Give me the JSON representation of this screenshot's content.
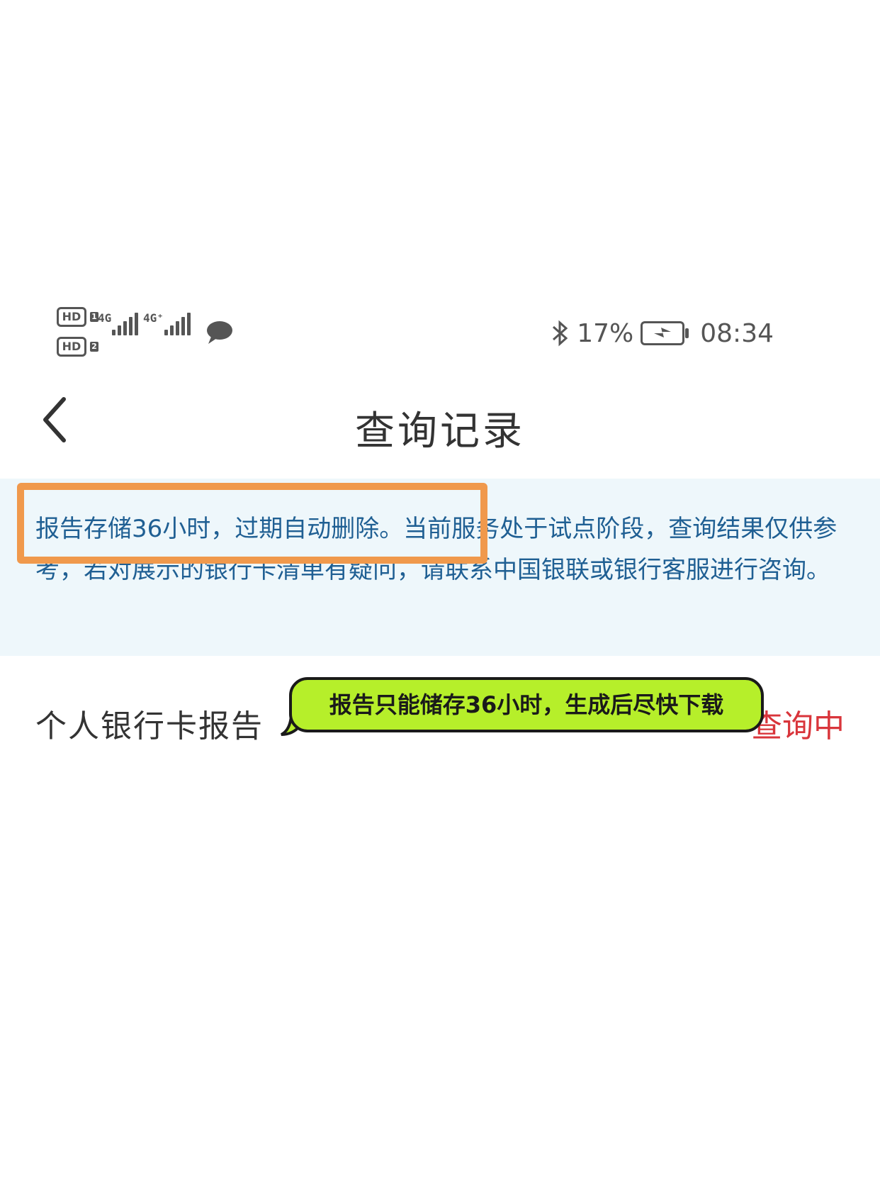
{
  "status_bar": {
    "sim1": "HD",
    "sim1_num": "1",
    "sim2": "HD",
    "sim2_num": "2",
    "net1": "4G",
    "net2": "4G⁺",
    "battery": "17%",
    "time": "08:34",
    "icons": [
      "bluetooth-icon",
      "battery-charging-icon",
      "message-icon",
      "signal-icon"
    ]
  },
  "nav": {
    "title": "查询记录",
    "back_icon": "chevron-left-icon"
  },
  "notice": {
    "text": "报告存储36小时，过期自动删除。当前服务处于试点阶段，查询结果仅供参考，若对展示的银行卡清单有疑问，请联系中国银联或银行客服进行咨询。"
  },
  "report": {
    "label": "个人银行卡报告",
    "status": "查询中"
  },
  "annotation": {
    "callout": "报告只能储存36小时，生成后尽快下载"
  },
  "colors": {
    "notice_bg": "#eef7fb",
    "notice_text": "#1f5f93",
    "status_red": "#d9353b",
    "highlight_orange": "#f0994c",
    "callout_green": "#b6ef2a"
  }
}
